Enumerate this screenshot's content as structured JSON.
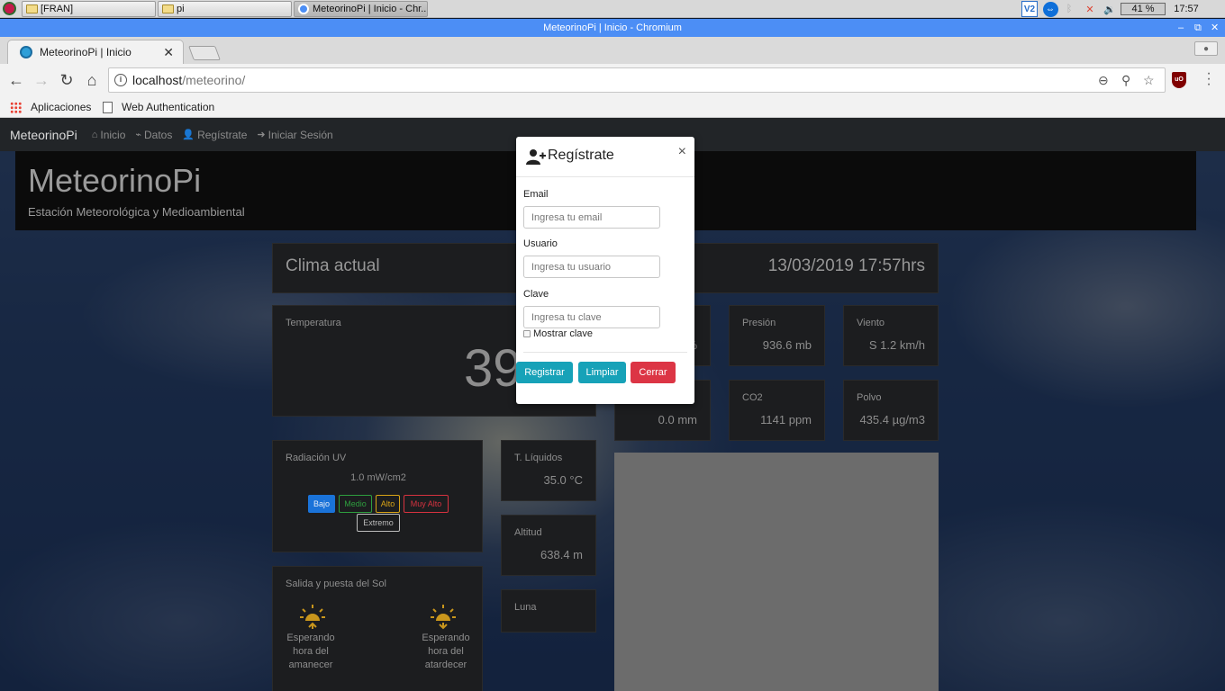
{
  "taskbar": {
    "items": [
      {
        "label": "[FRAN]"
      },
      {
        "label": "pi"
      },
      {
        "label": "MeteorinoPi | Inicio - Chr..."
      }
    ],
    "tray": {
      "vnc": "V2",
      "battery": "41 %",
      "clock": "17:57"
    }
  },
  "browser": {
    "window_title": "MeteorinoPi | Inicio - Chromium",
    "tab_title": "MeteorinoPi | Inicio",
    "url_host": "localhost",
    "url_path": "/meteorino/",
    "bookmarks": [
      {
        "label": "Aplicaciones"
      },
      {
        "label": "Web Authentication"
      }
    ],
    "ublock": "uO"
  },
  "site": {
    "brand": "MeteorinoPi",
    "nav": [
      {
        "label": "Inicio"
      },
      {
        "label": "Datos"
      },
      {
        "label": "Regístrate"
      },
      {
        "label": "Iniciar Sesión"
      }
    ],
    "title": "MeteorinoPi",
    "subtitle": "Estación Meteorológica y Medioambiental"
  },
  "clima": {
    "title": "Clima actual",
    "datetime": "13/03/2019 17:57hrs"
  },
  "temperatura": {
    "label": "Temperatura",
    "value": "39"
  },
  "cards": {
    "humedad_value": "%",
    "presion": {
      "label": "Presión",
      "value": "936.6 mb"
    },
    "viento": {
      "label": "Viento",
      "value": "S 1.2 km/h"
    },
    "lluvia_value": "0.0 mm",
    "co2": {
      "label": "CO2",
      "value": "1141 ppm"
    },
    "polvo": {
      "label": "Polvo",
      "value": "435.4 µg/m3"
    },
    "t_liquidos": {
      "label": "T. Líquidos",
      "value": "35.0 °C"
    },
    "altitud": {
      "label": "Altitud",
      "value": "638.4 m"
    },
    "luna": {
      "label": "Luna"
    }
  },
  "uv": {
    "label": "Radiación UV",
    "value": "1.0 mW/cm2",
    "levels": [
      {
        "label": "Bajo",
        "color": "#1a73d9"
      },
      {
        "label": "Medio",
        "color": "#2e9e3e"
      },
      {
        "label": "Alto",
        "color": "#d8a316"
      },
      {
        "label": "Muy Alto",
        "color": "#d6323f"
      },
      {
        "label": "Extremo",
        "color": "#bdbdbd"
      }
    ]
  },
  "sol": {
    "label": "Salida y puesta del Sol",
    "sunrise_lines": [
      "Esperando",
      "hora del",
      "amanecer"
    ],
    "sunset_lines": [
      "Esperando",
      "hora del",
      "atardecer"
    ],
    "sun_color": "#c9961c"
  },
  "modal": {
    "title": "Regístrate",
    "close": "×",
    "email_label": "Email",
    "email_placeholder": "Ingresa tu email",
    "user_label": "Usuario",
    "user_placeholder": "Ingresa tu usuario",
    "pass_label": "Clave",
    "pass_placeholder": "Ingresa tu clave",
    "show_pass": "Mostrar clave",
    "btn_register": "Registrar",
    "btn_clear": "Limpiar",
    "btn_close": "Cerrar",
    "colors": {
      "info": "#17a2b8",
      "danger": "#dc3545"
    }
  }
}
